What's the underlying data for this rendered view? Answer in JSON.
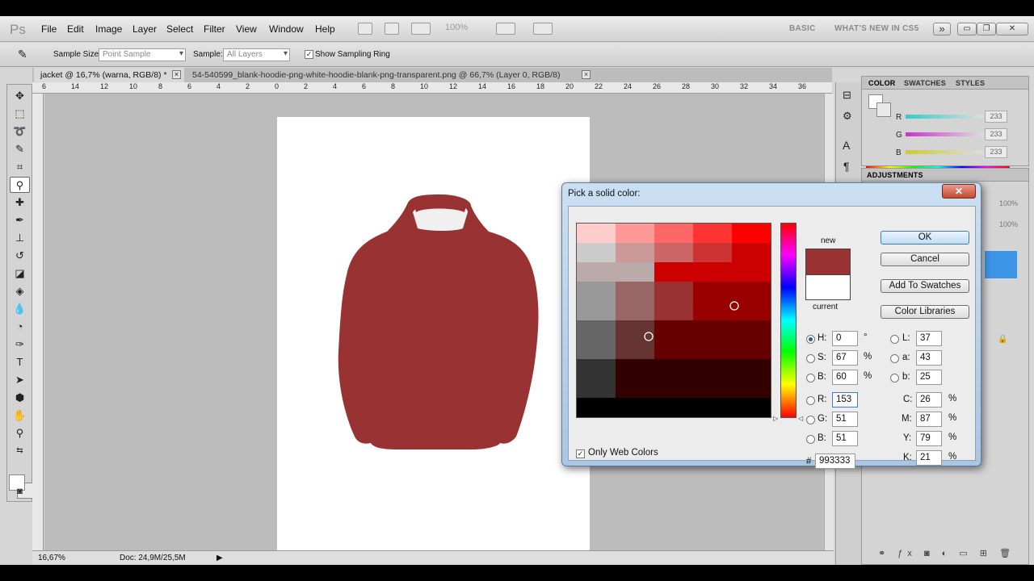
{
  "app": {
    "logo": "Ps"
  },
  "menu": [
    "File",
    "Edit",
    "Image",
    "Layer",
    "Select",
    "Filter",
    "View",
    "Window",
    "Help"
  ],
  "menubar": {
    "zoom": "100%",
    "workspace_basic": "BASIC",
    "workspace_new": "WHAT'S NEW IN CS5",
    "chevrons": "»"
  },
  "window_controls": {
    "minimize": "▭",
    "restore": "❐",
    "close": "✕"
  },
  "options": {
    "sample_size_label": "Sample Size:",
    "sample_size_value": "Point Sample",
    "sample_label": "Sample:",
    "sample_value": "All Layers",
    "sampling_ring_label": "Show Sampling Ring",
    "sampling_ring_checked": true
  },
  "tabs": [
    {
      "label": "jacket @ 16,7% (warna, RGB/8) *"
    },
    {
      "label": "54-540599_blank-hoodie-png-white-hoodie-blank-png-transparent.png @ 66,7% (Layer 0, RGB/8)"
    }
  ],
  "ruler": {
    "top_ticks": [
      "6",
      "14",
      "12",
      "10",
      "8",
      "6",
      "4",
      "2",
      "0",
      "2",
      "4",
      "6",
      "8",
      "10",
      "12",
      "14",
      "16",
      "18",
      "20",
      "22",
      "24",
      "26",
      "28",
      "30",
      "32",
      "34",
      "36"
    ]
  },
  "status": {
    "zoom": "16,67%",
    "doc": "Doc: 24,9M/25,5M"
  },
  "color_panel": {
    "tabs": [
      "COLOR",
      "SWATCHES",
      "STYLES"
    ],
    "channels": [
      {
        "label": "R",
        "value": "233",
        "track": "#33cccc"
      },
      {
        "label": "G",
        "value": "233",
        "track": "#cc33cc"
      },
      {
        "label": "B",
        "value": "233",
        "track": "#cccc33"
      }
    ]
  },
  "adjustments_panel": {
    "title": "ADJUSTMENTS",
    "opacity": "100%",
    "fill": "100%"
  },
  "dialog": {
    "title": "Pick a solid color:",
    "close": "✕",
    "new_label": "new",
    "current_label": "current",
    "new_color": "#993333",
    "current_color": "#ffffff",
    "buttons": {
      "ok": "OK",
      "cancel": "Cancel",
      "add_swatches": "Add To Swatches",
      "libraries": "Color Libraries"
    },
    "hsb": [
      {
        "label": "H:",
        "value": "0",
        "unit": "°",
        "selected": true
      },
      {
        "label": "S:",
        "value": "67",
        "unit": "%",
        "selected": false
      },
      {
        "label": "B:",
        "value": "60",
        "unit": "%",
        "selected": false
      }
    ],
    "rgb": [
      {
        "label": "R:",
        "value": "153",
        "selected": false
      },
      {
        "label": "G:",
        "value": "51",
        "selected": false
      },
      {
        "label": "B:",
        "value": "51",
        "selected": false
      }
    ],
    "lab": [
      {
        "label": "L:",
        "value": "37"
      },
      {
        "label": "a:",
        "value": "43"
      },
      {
        "label": "b:",
        "value": "25"
      }
    ],
    "cmyk": [
      {
        "label": "C:",
        "value": "26",
        "unit": "%"
      },
      {
        "label": "M:",
        "value": "87",
        "unit": "%"
      },
      {
        "label": "Y:",
        "value": "79",
        "unit": "%"
      },
      {
        "label": "K:",
        "value": "21",
        "unit": "%"
      }
    ],
    "hex_label": "#",
    "hex_value": "993333",
    "web_colors_label": "Only Web Colors",
    "web_colors_checked": true
  },
  "hoodie_color": "#993333"
}
